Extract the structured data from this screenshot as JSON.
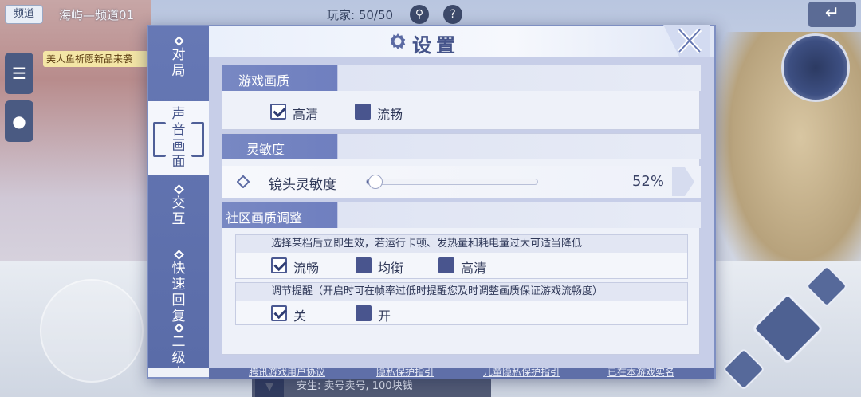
{
  "hud": {
    "channel_button": "频道",
    "channel_name": "海屿—频道01",
    "player_count": "玩家: 50/50",
    "promo": "美人鱼祈愿新品来袭",
    "chat_message": "安生: 卖号卖号, 100块钱"
  },
  "dialog": {
    "title": "设置",
    "sidebar": [
      {
        "label": "对局",
        "active": false
      },
      {
        "label": "声音画面",
        "active": true
      },
      {
        "label": "交互",
        "active": false
      },
      {
        "label": "快速回复",
        "active": false
      },
      {
        "label": "二级密",
        "active": false
      }
    ],
    "quality": {
      "title": "游戏画质",
      "options": [
        {
          "label": "高清",
          "checked": true
        },
        {
          "label": "流畅",
          "checked": false
        }
      ]
    },
    "sensitivity": {
      "title": "灵敏度",
      "label": "镜头灵敏度",
      "value_text": "52%",
      "value": 0.05
    },
    "community": {
      "title": "社区画质调整",
      "panel1": {
        "header": "选择某档后立即生效，若运行卡顿、发热量和耗电量过大可适当降低",
        "options": [
          {
            "label": "流畅",
            "checked": true
          },
          {
            "label": "均衡",
            "checked": false
          },
          {
            "label": "高清",
            "checked": false
          }
        ]
      },
      "panel2": {
        "header": "调节提醒（开启时可在帧率过低时提醒您及时调整画质保证游戏流畅度）",
        "options": [
          {
            "label": "关",
            "checked": true
          },
          {
            "label": "开",
            "checked": false
          }
        ]
      }
    },
    "footer": [
      "腾讯游戏用户协议",
      "隐私保护指引",
      "儿童隐私保护指引",
      "已在本游戏实名"
    ]
  },
  "colors": {
    "accent": "#4a5891",
    "sidebar": "#6678b5",
    "frame": "#7e8fc2"
  },
  "icons": [
    "gear-icon",
    "close-icon",
    "search-icon",
    "help-icon",
    "back-arrow-icon",
    "diamond-icon"
  ]
}
